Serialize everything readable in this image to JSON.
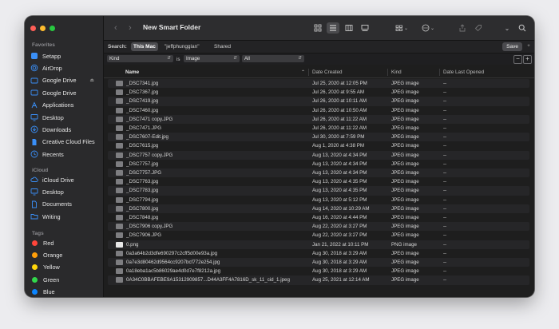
{
  "window": {
    "title": "New Smart Folder"
  },
  "sidebar": {
    "favorites_heading": "Favorites",
    "favorites": [
      {
        "label": "Setapp",
        "icon": "setapp-icon"
      },
      {
        "label": "AirDrop",
        "icon": "airdrop-icon"
      },
      {
        "label": "Google Drive",
        "icon": "drive-icon"
      },
      {
        "label": "Google Drive",
        "icon": "drive-icon"
      },
      {
        "label": "Applications",
        "icon": "applications-icon"
      },
      {
        "label": "Desktop",
        "icon": "desktop-icon"
      },
      {
        "label": "Downloads",
        "icon": "downloads-icon"
      },
      {
        "label": "Creative Cloud Files",
        "icon": "document-icon"
      },
      {
        "label": "Recents",
        "icon": "clock-icon"
      }
    ],
    "icloud_heading": "iCloud",
    "icloud": [
      {
        "label": "iCloud Drive",
        "icon": "cloud-icon"
      },
      {
        "label": "Desktop",
        "icon": "desktop-icon"
      },
      {
        "label": "Documents",
        "icon": "documents-icon"
      },
      {
        "label": "Writing",
        "icon": "folder-icon"
      }
    ],
    "tags_heading": "Tags",
    "tags": [
      {
        "label": "Red",
        "color": "#ff453a"
      },
      {
        "label": "Orange",
        "color": "#ff9f0a"
      },
      {
        "label": "Yellow",
        "color": "#ffd60a"
      },
      {
        "label": "Green",
        "color": "#32d74b"
      },
      {
        "label": "Blue",
        "color": "#0a84ff"
      }
    ]
  },
  "search": {
    "label": "Search:",
    "scopes": [
      "This Mac",
      "\"jeffphungglan\"",
      "Shared"
    ],
    "active_scope": "This Mac",
    "save_label": "Save"
  },
  "criteria": {
    "attribute": "Kind",
    "operator": "is",
    "value": "Image",
    "qualifier": "All"
  },
  "columns": {
    "name": "Name",
    "date_created": "Date Created",
    "kind": "Kind",
    "date_last_opened": "Date Last Opened"
  },
  "files": [
    {
      "name": "_DSC7341.jpg",
      "date": "Jul 25, 2020 at 12:05 PM",
      "kind": "JPEG image",
      "opened": "--"
    },
    {
      "name": "_DSC7367.jpg",
      "date": "Jul 26, 2020 at 9:55 AM",
      "kind": "JPEG image",
      "opened": "--"
    },
    {
      "name": "_DSC7419.jpg",
      "date": "Jul 26, 2020 at 10:11 AM",
      "kind": "JPEG image",
      "opened": "--"
    },
    {
      "name": "_DSC7460.jpg",
      "date": "Jul 26, 2020 at 10:50 AM",
      "kind": "JPEG image",
      "opened": "--"
    },
    {
      "name": "_DSC7471 copy.JPG",
      "date": "Jul 26, 2020 at 11:22 AM",
      "kind": "JPEG image",
      "opened": "--"
    },
    {
      "name": "_DSC7471.JPG",
      "date": "Jul 26, 2020 at 11:22 AM",
      "kind": "JPEG image",
      "opened": "--"
    },
    {
      "name": "_DSC7607-Edit.jpg",
      "date": "Jul 30, 2020 at 7:59 PM",
      "kind": "JPEG image",
      "opened": "--"
    },
    {
      "name": "_DSC7615.jpg",
      "date": "Aug 1, 2020 at 4:38 PM",
      "kind": "JPEG image",
      "opened": "--"
    },
    {
      "name": "_DSC7757 copy.JPG",
      "date": "Aug 13, 2020 at 4:34 PM",
      "kind": "JPEG image",
      "opened": "--"
    },
    {
      "name": "_DSC7757.jpg",
      "date": "Aug 13, 2020 at 4:34 PM",
      "kind": "JPEG image",
      "opened": "--"
    },
    {
      "name": "_DSC7757.JPG",
      "date": "Aug 13, 2020 at 4:34 PM",
      "kind": "JPEG image",
      "opened": "--"
    },
    {
      "name": "_DSC7763.jpg",
      "date": "Aug 13, 2020 at 4:35 PM",
      "kind": "JPEG image",
      "opened": "--"
    },
    {
      "name": "_DSC7783.jpg",
      "date": "Aug 13, 2020 at 4:35 PM",
      "kind": "JPEG image",
      "opened": "--"
    },
    {
      "name": "_DSC7794.jpg",
      "date": "Aug 13, 2020 at 5:12 PM",
      "kind": "JPEG image",
      "opened": "--"
    },
    {
      "name": "_DSC7800.jpg",
      "date": "Aug 14, 2020 at 10:29 AM",
      "kind": "JPEG image",
      "opened": "--"
    },
    {
      "name": "_DSC7848.jpg",
      "date": "Aug 16, 2020 at 4:44 PM",
      "kind": "JPEG image",
      "opened": "--"
    },
    {
      "name": "_DSC7906 copy.JPG",
      "date": "Aug 22, 2020 at 3:27 PM",
      "kind": "JPEG image",
      "opened": "--"
    },
    {
      "name": "_DSC7906.JPG",
      "date": "Aug 22, 2020 at 3:27 PM",
      "kind": "JPEG image",
      "opened": "--"
    },
    {
      "name": "0.png",
      "date": "Jan 21, 2022 at 10:11 PM",
      "kind": "PNG image",
      "opened": "--"
    },
    {
      "name": "0a3a64b2d3dfe690297c2cff5d00e93a.jpg",
      "date": "Aug 30, 2018 at 3:29 AM",
      "kind": "JPEG image",
      "opened": "--"
    },
    {
      "name": "0a7e3d80462d9564cc9207bcf772e254.jpg",
      "date": "Aug 30, 2018 at 3:29 AM",
      "kind": "JPEG image",
      "opened": "--"
    },
    {
      "name": "0a18eba1ac5b86029ae4d0d7e7f8212a.jpg",
      "date": "Aug 30, 2018 at 3:29 AM",
      "kind": "JPEG image",
      "opened": "--"
    },
    {
      "name": "0A34C0BBAFEBE9A15312909857...D44A3FF4A7816D_sk_11_cid_1.jpeg",
      "date": "Aug 25, 2021 at 12:14 AM",
      "kind": "JPEG image",
      "opened": "--"
    }
  ]
}
